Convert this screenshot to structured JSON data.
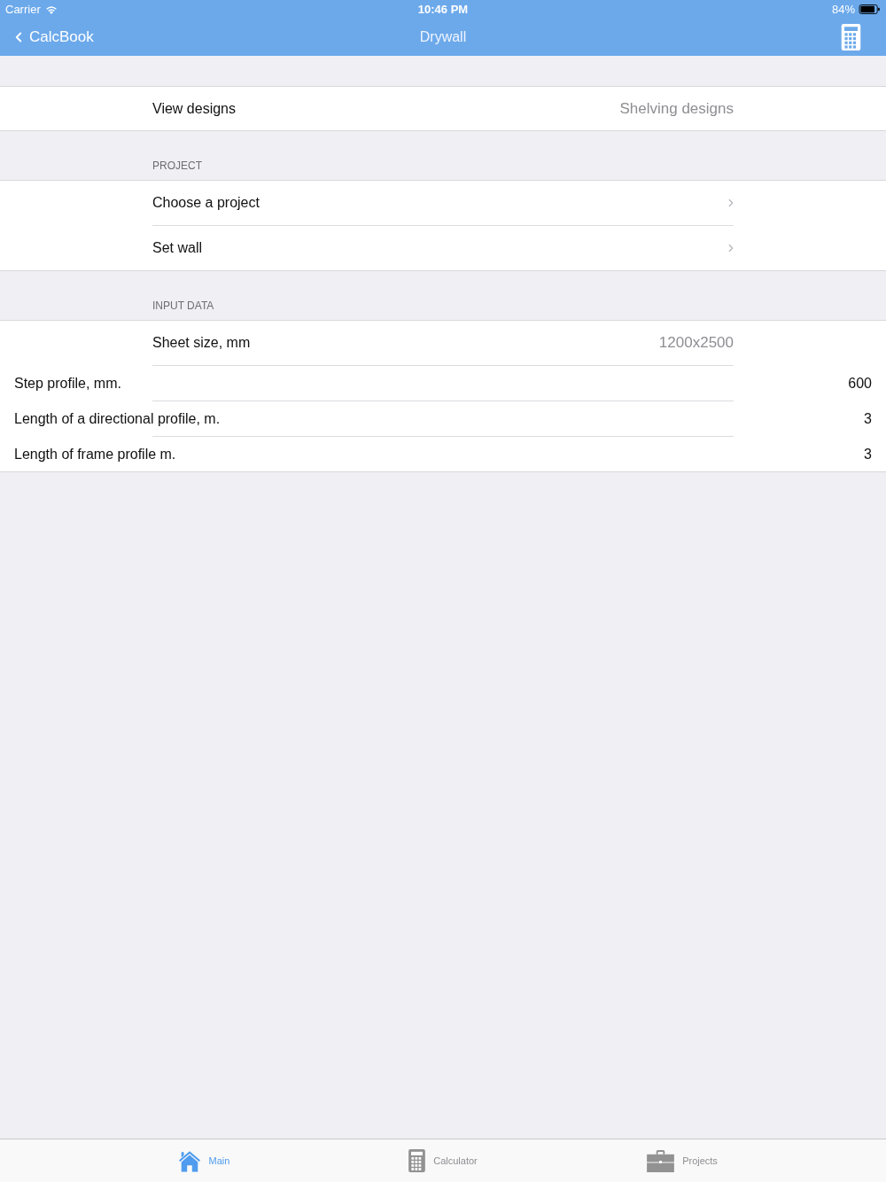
{
  "status_bar": {
    "carrier": "Carrier",
    "time": "10:46 PM",
    "battery": "84%"
  },
  "nav_bar": {
    "back": "CalcBook",
    "title": "Drywall"
  },
  "designs": {
    "label": "View designs",
    "value": "Shelving designs"
  },
  "sections": [
    {
      "header": "PROJECT",
      "rows": [
        {
          "kind": "link",
          "label": "Choose a project"
        },
        {
          "kind": "link",
          "label": "Set wall"
        }
      ]
    },
    {
      "header": "INPUT DATA",
      "rows": [
        {
          "kind": "value",
          "label": "Sheet size, mm",
          "value": "1200x2500"
        },
        {
          "kind": "field",
          "label": "Step profile, mm.",
          "value": "600"
        },
        {
          "kind": "field",
          "label": "Length of a directional profile, m.",
          "value": "3"
        },
        {
          "kind": "field",
          "label": "Length of frame profile m.",
          "value": "3"
        }
      ]
    }
  ],
  "tab_bar": {
    "tabs": [
      {
        "kind": "home",
        "label": "Main",
        "selected": true
      },
      {
        "kind": "calculator",
        "label": "Calculator",
        "selected": false
      },
      {
        "kind": "briefcase",
        "label": "Projects",
        "selected": false
      }
    ]
  }
}
